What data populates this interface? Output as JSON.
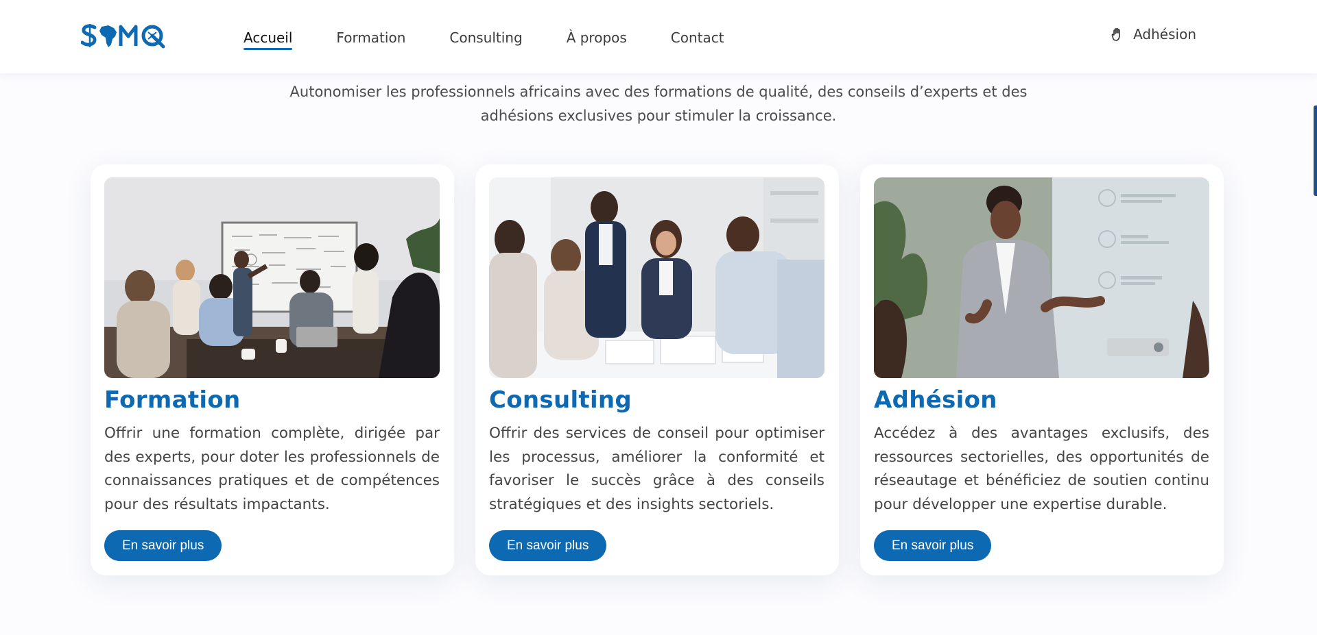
{
  "brand": {
    "logo_text": "SAMQ",
    "logo_icon": "samq-logo-with-africa",
    "primary_color": "#0e69b3"
  },
  "nav": {
    "items": [
      {
        "label": "Accueil",
        "active": true
      },
      {
        "label": "Formation",
        "active": false
      },
      {
        "label": "Consulting",
        "active": false
      },
      {
        "label": "À propos",
        "active": false
      },
      {
        "label": "Contact",
        "active": false
      }
    ],
    "join": {
      "label": "Adhésion",
      "icon": "hand-icon"
    }
  },
  "intro": {
    "line1": "Autonomiser les professionnels africains avec des formations de qualité, des conseils d’experts et des",
    "line2": "adhésions exclusives pour stimuler la croissance."
  },
  "cards": [
    {
      "title": "Formation",
      "text": "Offrir une formation complète, dirigée par des experts, pour doter les professionnels de connaissances pratiques et de compétences pour des résultats impactants.",
      "button": "En savoir plus",
      "image": "team-training-whiteboard-photo"
    },
    {
      "title": "Consulting",
      "text": "Offrir des services de conseil pour optimiser les processus, améliorer la conformité et favoriser le succès grâce à des conseils stratégiques et des insights sectoriels.",
      "button": "En savoir plus",
      "image": "consultants-meeting-photo"
    },
    {
      "title": "Adhésion",
      "text": "Accédez à des avantages exclusifs, des ressources sectorielles, des opportunités de réseautage et bénéficiez de soutien continu pour développer une expertise durable.",
      "button": "En savoir plus",
      "image": "speaker-presentation-photo"
    }
  ]
}
